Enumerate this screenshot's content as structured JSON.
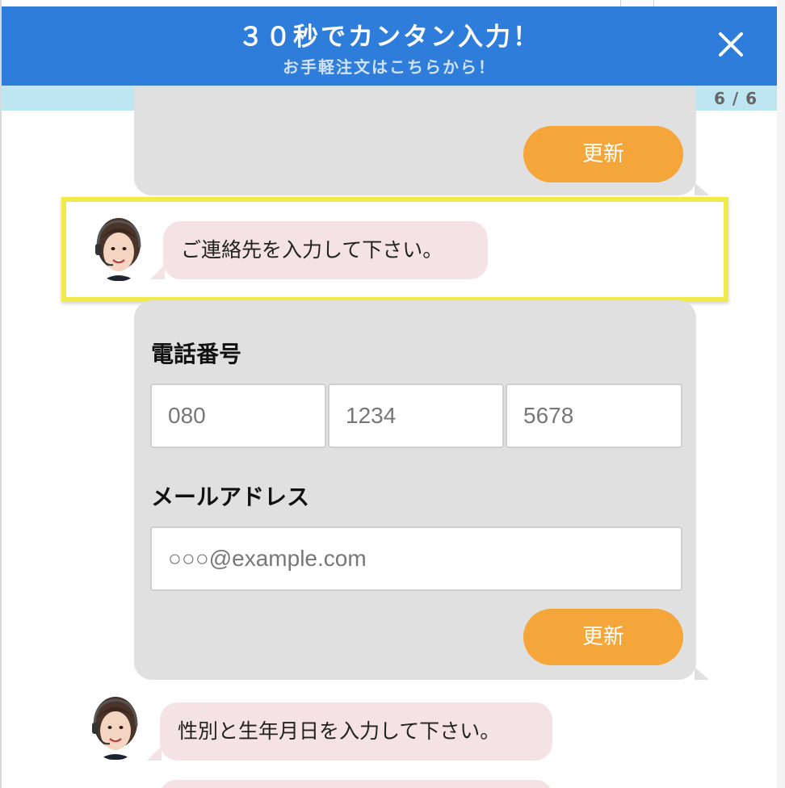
{
  "header": {
    "title": "３０秒でカンタン入力！",
    "subtitle": "お手軽注文はこちらから！",
    "close_icon": "close-icon"
  },
  "progress": {
    "text": "6 / 6"
  },
  "top_form": {
    "button_label": "更新"
  },
  "messages": {
    "contact_prompt": "ご連絡先を入力して下さい。",
    "gender_prompt": "性別と生年月日を入力して下さい。"
  },
  "contact_form": {
    "phone_label": "電話番号",
    "phone_parts": [
      "080",
      "1234",
      "5678"
    ],
    "email_label": "メールアドレス",
    "email_placeholder": "○○○@example.com",
    "button_label": "更新"
  },
  "colors": {
    "header": "#2f7ddb",
    "progress_bar": "#bde6f2",
    "button": "#f4a63b",
    "bot_bubble": "#f4e2e4",
    "form_bubble": "#e0e0e0",
    "highlight": "#f2e94a"
  }
}
